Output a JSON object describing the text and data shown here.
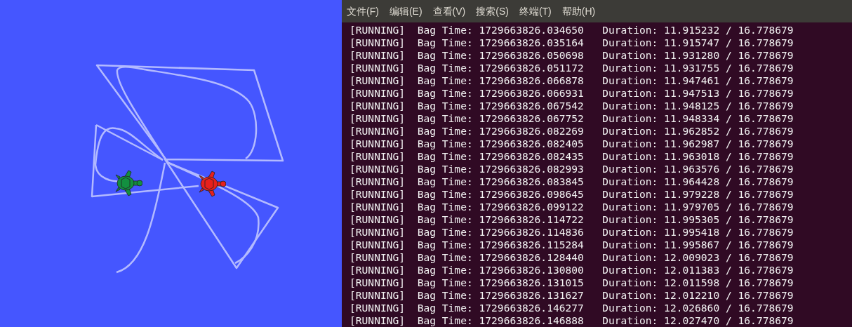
{
  "turtles": [
    {
      "color": "#139040"
    },
    {
      "color": "#e8201c"
    }
  ],
  "menu": [
    "文件(F)",
    "编辑(E)",
    "查看(V)",
    "搜索(S)",
    "终端(T)",
    "帮助(H)"
  ],
  "lines": [
    "[RUNNING]  Bag Time: 1729663826.034650   Duration: 11.915232 / 16.778679",
    "[RUNNING]  Bag Time: 1729663826.035164   Duration: 11.915747 / 16.778679",
    "[RUNNING]  Bag Time: 1729663826.050698   Duration: 11.931280 / 16.778679",
    "[RUNNING]  Bag Time: 1729663826.051172   Duration: 11.931755 / 16.778679",
    "[RUNNING]  Bag Time: 1729663826.066878   Duration: 11.947461 / 16.778679",
    "[RUNNING]  Bag Time: 1729663826.066931   Duration: 11.947513 / 16.778679",
    "[RUNNING]  Bag Time: 1729663826.067542   Duration: 11.948125 / 16.778679",
    "[RUNNING]  Bag Time: 1729663826.067752   Duration: 11.948334 / 16.778679",
    "[RUNNING]  Bag Time: 1729663826.082269   Duration: 11.962852 / 16.778679",
    "[RUNNING]  Bag Time: 1729663826.082405   Duration: 11.962987 / 16.778679",
    "[RUNNING]  Bag Time: 1729663826.082435   Duration: 11.963018 / 16.778679",
    "[RUNNING]  Bag Time: 1729663826.082993   Duration: 11.963576 / 16.778679",
    "[RUNNING]  Bag Time: 1729663826.083845   Duration: 11.964428 / 16.778679",
    "[RUNNING]  Bag Time: 1729663826.098645   Duration: 11.979228 / 16.778679",
    "[RUNNING]  Bag Time: 1729663826.099122   Duration: 11.979705 / 16.778679",
    "[RUNNING]  Bag Time: 1729663826.114722   Duration: 11.995305 / 16.778679",
    "[RUNNING]  Bag Time: 1729663826.114836   Duration: 11.995418 / 16.778679",
    "[RUNNING]  Bag Time: 1729663826.115284   Duration: 11.995867 / 16.778679",
    "[RUNNING]  Bag Time: 1729663826.128440   Duration: 12.009023 / 16.778679",
    "[RUNNING]  Bag Time: 1729663826.130800   Duration: 12.011383 / 16.778679",
    "[RUNNING]  Bag Time: 1729663826.131015   Duration: 12.011598 / 16.778679",
    "[RUNNING]  Bag Time: 1729663826.131627   Duration: 12.012210 / 16.778679",
    "[RUNNING]  Bag Time: 1729663826.146277   Duration: 12.026860 / 16.778679",
    "[RUNNING]  Bag Time: 1729663826.146888   Duration: 12.027470 / 16.778679"
  ]
}
